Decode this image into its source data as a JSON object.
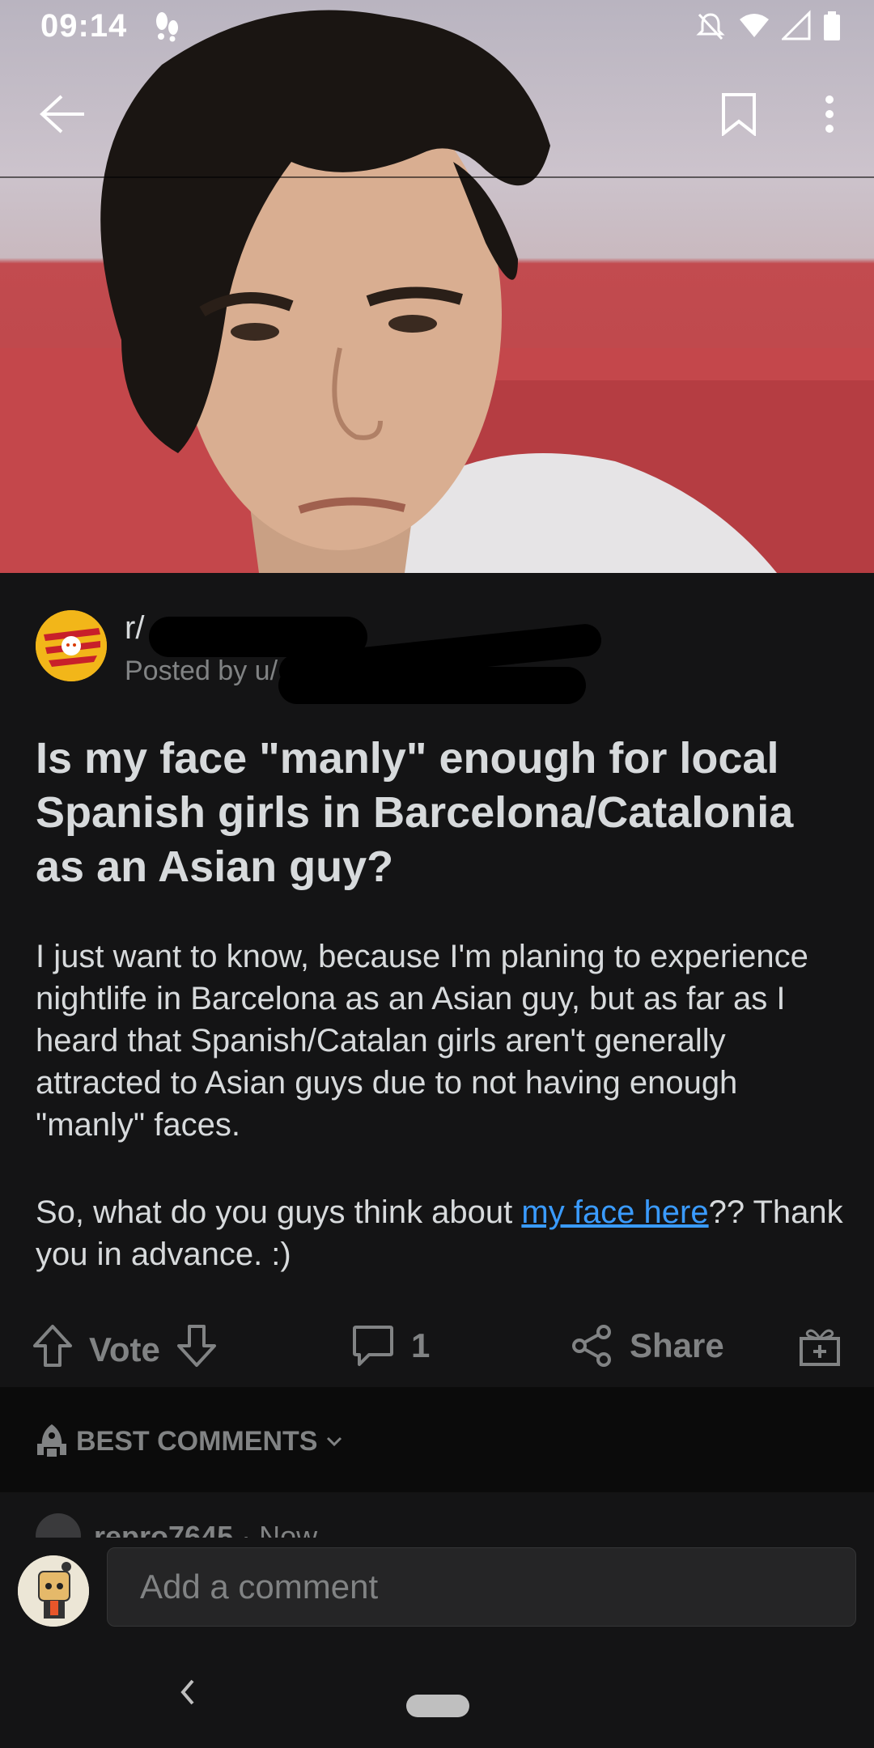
{
  "status_bar": {
    "time": "09:14"
  },
  "post": {
    "subreddit_prefix": "r/",
    "posted_by_prefix": "Posted by u/",
    "title": "Is my face \"manly\" enough for local Spanish girls in Barcelona/Catalonia as an Asian guy?",
    "body_p1": "I just want to know, because I'm planing to experience nightlife in Barcelona as an Asian guy, but as far as I heard that Spanish/Catalan girls aren't generally attracted to Asian guys due to not having enough \"manly\" faces.",
    "body_p2_prefix": "So, what do you guys think about ",
    "body_p2_link": "my face here",
    "body_p2_suffix": "?? Thank you in advance. :)"
  },
  "actions": {
    "vote_label": "Vote",
    "comment_count": "1",
    "share_label": "Share"
  },
  "comments": {
    "sort_label": "BEST COMMENTS",
    "peek_user": "repro7645",
    "peek_time": "· Now",
    "input_placeholder": "Add a comment"
  },
  "colors": {
    "background": "#141415",
    "text": "#d7dadc",
    "muted": "#818384",
    "link": "#3a9bff",
    "subreddit_icon": "#f2b619"
  },
  "icons": [
    "back-arrow-icon",
    "bookmark-icon",
    "more-vertical-icon",
    "upvote-icon",
    "downvote-icon",
    "comment-icon",
    "share-icon",
    "award-icon",
    "rocket-icon",
    "chevron-down-icon"
  ]
}
